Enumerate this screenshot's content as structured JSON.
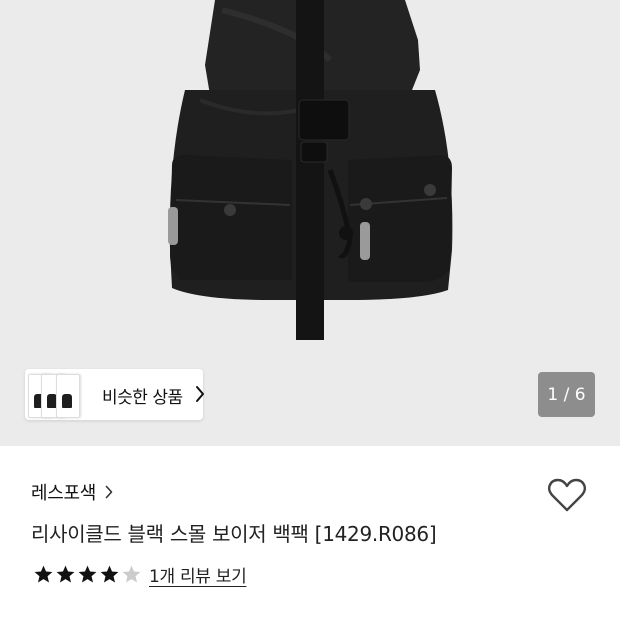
{
  "gallery": {
    "similar_label": "비슷한 상품",
    "counter": "1 / 6"
  },
  "product": {
    "brand": "레스포색",
    "title": "리사이클드 블랙 스몰 보이저 백팩 [1429.R086]",
    "rating": 4,
    "rating_max": 5,
    "review_link": "1개 리뷰 보기"
  },
  "colors": {
    "hero_bg": "#ebebeb",
    "star_filled": "#111111",
    "star_empty": "#cccccc",
    "counter_bg": "#8d8d8d"
  },
  "icons": {
    "wishlist": "heart-outline-icon",
    "brand_arrow": "chevron-right-icon",
    "similar_arrow": "chevron-right-icon"
  }
}
